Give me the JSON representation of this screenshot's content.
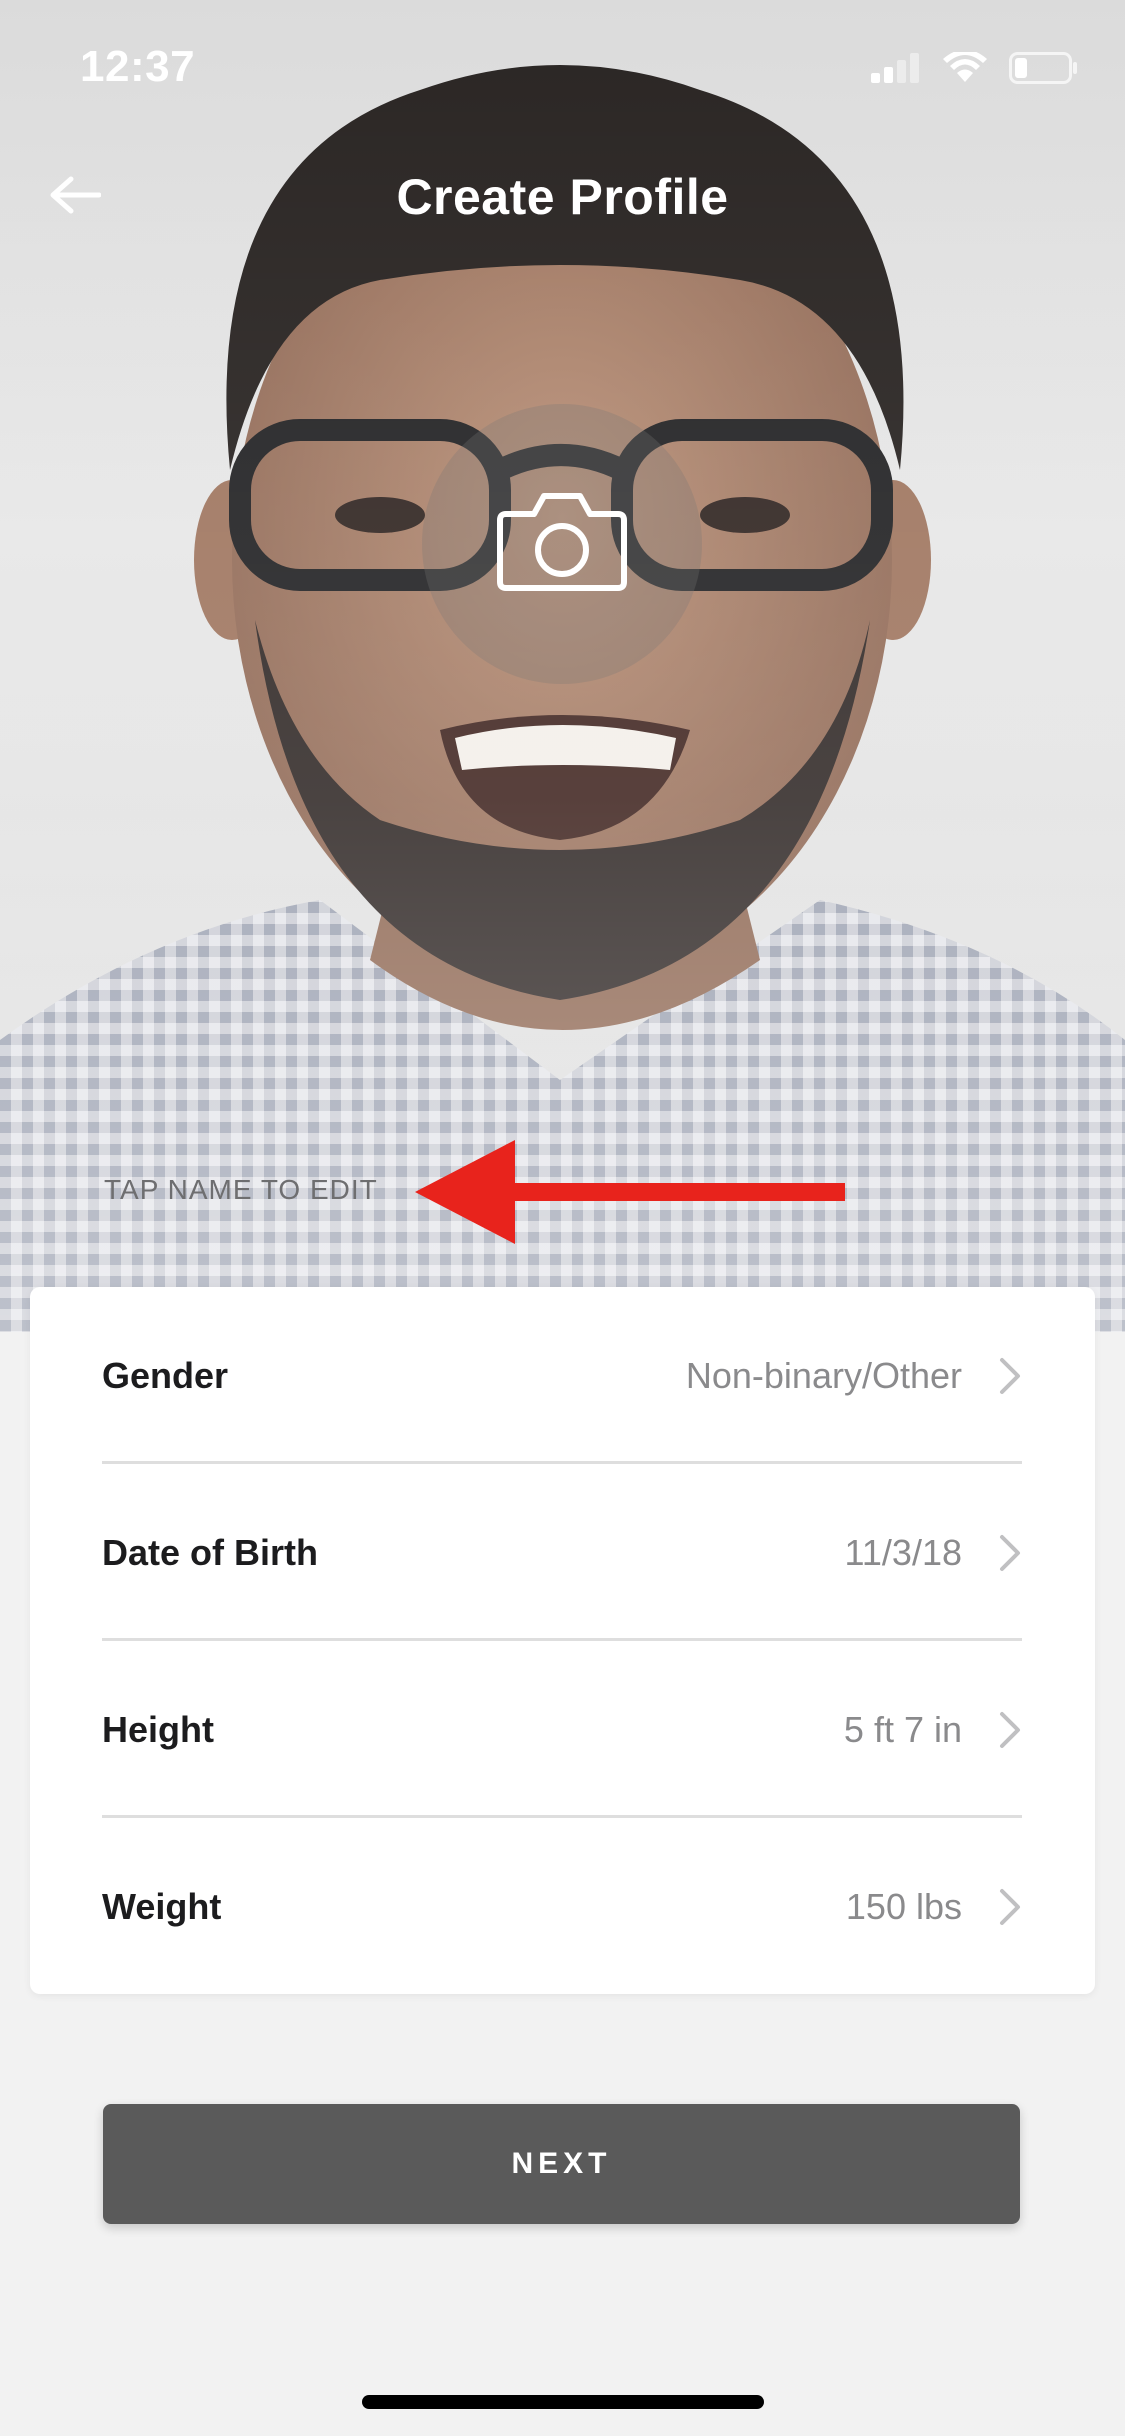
{
  "status_bar": {
    "time": "12:37",
    "icons": [
      "signal-icon",
      "wifi-icon",
      "battery-icon"
    ]
  },
  "nav": {
    "title": "Create Profile",
    "back_icon": "back-arrow-icon"
  },
  "photo": {
    "camera_icon": "camera-icon"
  },
  "name_hint": "TAP NAME TO EDIT",
  "annotation": {
    "arrow_color": "#e8231c"
  },
  "details": {
    "rows": [
      {
        "label": "Gender",
        "value": "Non-binary/Other"
      },
      {
        "label": "Date of Birth",
        "value": "11/3/18"
      },
      {
        "label": "Height",
        "value": "5 ft 7 in"
      },
      {
        "label": "Weight",
        "value": "150 lbs"
      }
    ]
  },
  "next_button": {
    "label": "NEXT"
  },
  "colors": {
    "primary_button": "#5a5a5a",
    "label_text": "#1c1c1e",
    "value_text": "#8a8a8c",
    "background": "#f2f2f2"
  }
}
